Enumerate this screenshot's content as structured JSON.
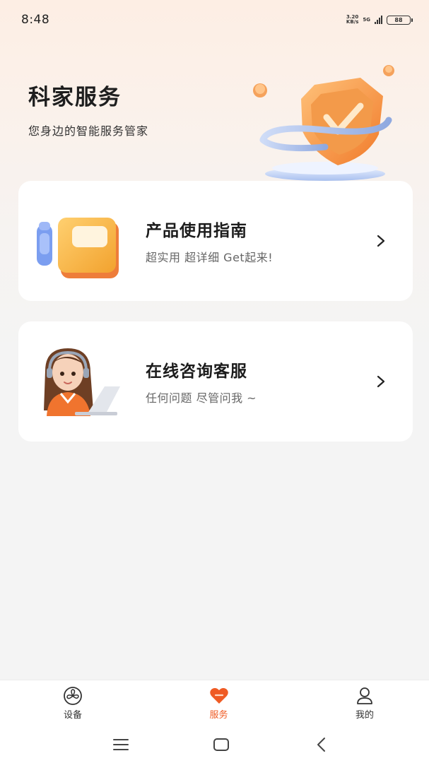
{
  "status_bar": {
    "time": "8:48",
    "net_speed_value": "3.20",
    "net_speed_unit": "KB/s",
    "network": "5G",
    "battery": "88"
  },
  "hero": {
    "title": "科家服务",
    "subtitle": "您身边的智能服务管家",
    "icon": "shield-check-icon"
  },
  "cards": [
    {
      "title": "产品使用指南",
      "description": "超实用 超详细 Get起来!",
      "icon": "guide-book-icon"
    },
    {
      "title": "在线咨询客服",
      "description": "任何问题 尽管问我 ~",
      "icon": "customer-service-avatar"
    }
  ],
  "tab_bar": {
    "items": [
      {
        "label": "设备",
        "icon": "fan-icon",
        "active": false
      },
      {
        "label": "服务",
        "icon": "heart-icon",
        "active": true
      },
      {
        "label": "我的",
        "icon": "person-icon",
        "active": false
      }
    ]
  },
  "colors": {
    "accent": "#ef5b24",
    "card_bg": "#ffffff",
    "page_bg": "#f4f4f4"
  }
}
